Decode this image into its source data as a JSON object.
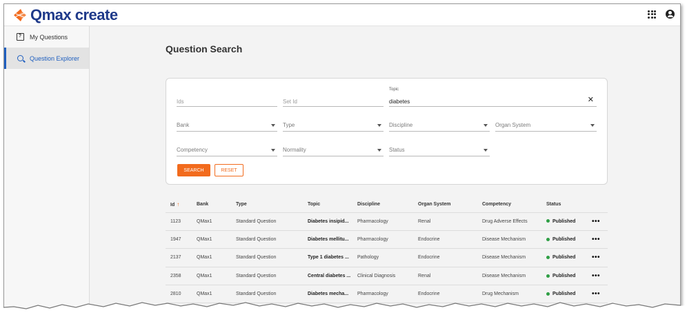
{
  "app": {
    "name": "Qmax create",
    "brand_color": "#1f3a8a",
    "accent_color": "#f26b1d"
  },
  "header": {
    "apps_icon": "grid-apps-icon",
    "account_icon": "account-circle-icon"
  },
  "sidebar": {
    "items": [
      {
        "label": "My Questions",
        "icon": "question-book-icon",
        "active": false
      },
      {
        "label": "Question Explorer",
        "icon": "search-icon",
        "active": true
      }
    ]
  },
  "main": {
    "title": "Question Search"
  },
  "search": {
    "ids_placeholder": "Ids",
    "setid_placeholder": "Set Id",
    "topic_label": "Topic",
    "topic_value": "diabetes",
    "bank_placeholder": "Bank",
    "type_placeholder": "Type",
    "discipline_placeholder": "Discipline",
    "organ_system_placeholder": "Organ System",
    "competency_placeholder": "Competency",
    "normality_placeholder": "Normality",
    "status_placeholder": "Status",
    "search_label": "SEARCH",
    "reset_label": "RESET"
  },
  "table": {
    "columns": [
      "Id",
      "Bank",
      "Type",
      "Topic",
      "Discipline",
      "Organ System",
      "Competency",
      "Status"
    ],
    "sort_column": "Id",
    "sort_direction": "ascending",
    "rows": [
      {
        "id": "1123",
        "bank": "QMax1",
        "type": "Standard Question",
        "topic": "Diabetes insipid...",
        "discipline": "Pharmacology",
        "organ": "Renal",
        "competency": "Drug Adverse Effects",
        "status": "Published"
      },
      {
        "id": "1947",
        "bank": "QMax1",
        "type": "Standard Question",
        "topic": "Diabetes mellitu...",
        "discipline": "Pharmacology",
        "organ": "Endocrine",
        "competency": "Disease Mechanism",
        "status": "Published"
      },
      {
        "id": "2137",
        "bank": "QMax1",
        "type": "Standard Question",
        "topic": "Type 1 diabetes ...",
        "discipline": "Pathology",
        "organ": "Endocrine",
        "competency": "Disease Mechanism",
        "status": "Published"
      },
      {
        "id": "2358",
        "bank": "QMax1",
        "type": "Standard Question",
        "topic": "Central diabetes ...",
        "discipline": "Clinical Diagnosis",
        "organ": "Renal",
        "competency": "Disease Mechanism",
        "status": "Published"
      },
      {
        "id": "2810",
        "bank": "QMax1",
        "type": "Standard Question",
        "topic": "Diabetes mecha...",
        "discipline": "Pharmacology",
        "organ": "Endocrine",
        "competency": "Drug Mechanism",
        "status": "Published"
      }
    ],
    "more_icon": "more-horizontal-icon",
    "status_color": "#2e9e44"
  }
}
